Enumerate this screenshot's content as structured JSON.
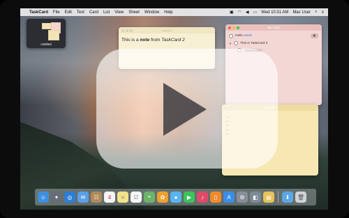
{
  "menubar": {
    "app_name": "TaskCard",
    "menus": [
      "File",
      "Edit",
      "Text",
      "Card",
      "List",
      "View",
      "Sheet",
      "Window",
      "Help"
    ],
    "clock": "Wed 10:31 AM",
    "user": "Mac User"
  },
  "thumbnail": {
    "label": "Untitled"
  },
  "note_card": {
    "body_prefix": "This is a ",
    "body_bold": "note",
    "body_middle": " from ",
    "body_italic": "TaskCard 2"
  },
  "my_card": {
    "title": "My Card",
    "item1_prefix": "Hello ",
    "item1_highlight": "world",
    "item2": "This is TaskCard 2",
    "badge": "Nested task"
  },
  "my_list": {
    "title": "My List"
  },
  "dock": {
    "icons": [
      "finder-icon",
      "launchpad-icon",
      "safari-icon",
      "mail-icon",
      "contacts-icon",
      "calendar-icon",
      "notes-icon",
      "reminders-icon",
      "maps-icon",
      "photos-icon",
      "messages-icon",
      "facetime-icon",
      "music-icon",
      "books-icon",
      "appstore-icon",
      "settings-icon",
      "preview-icon",
      "taskcard-icon",
      "downloads-icon",
      "trash-icon"
    ]
  },
  "colors": {
    "note_yellow": "#f7f0d4",
    "card_pink": "#f3d7d4",
    "list_yellow": "#f6e7b3"
  }
}
